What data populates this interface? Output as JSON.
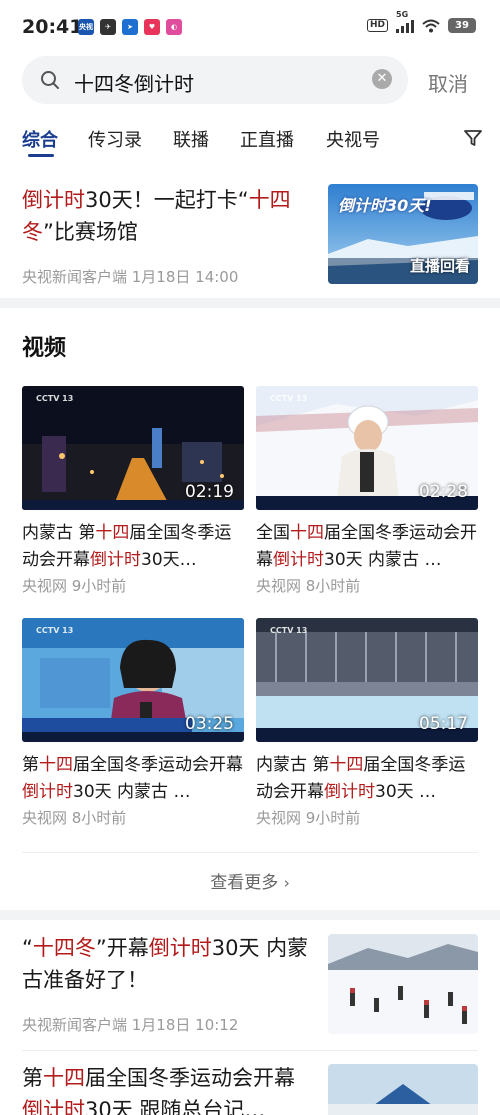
{
  "status_bar": {
    "time": "20:41",
    "hd_label": "HD",
    "network": "5G",
    "battery": "39",
    "apps": [
      {
        "label": "央视",
        "color": "#1a56b0"
      },
      {
        "label": "✈",
        "color": "#333333"
      },
      {
        "label": "➤",
        "color": "#1f6fd1"
      },
      {
        "label": "♥",
        "color": "#e8335a"
      },
      {
        "label": "◐",
        "color": "#e04d9c"
      }
    ]
  },
  "search": {
    "query": "十四冬倒计时",
    "cancel_label": "取消"
  },
  "tabs": [
    "综合",
    "传习录",
    "联播",
    "正直播",
    "央视号"
  ],
  "top_news": {
    "title_parts": [
      {
        "text": "倒计时",
        "hl": true
      },
      {
        "text": "30天！一起打卡“",
        "hl": false
      },
      {
        "text": "十四冬",
        "hl": true
      },
      {
        "text": "”比赛场馆",
        "hl": false
      }
    ],
    "meta": "央视新闻客户端  1月18日 14:00",
    "thumb_badge": "直播回看",
    "thumb_caption": "倒计时30天!"
  },
  "video_section": {
    "title": "视频",
    "more_label": "查看更多"
  },
  "videos": [
    {
      "duration": "02:19",
      "title_parts": [
        {
          "text": "内蒙古 第",
          "hl": false
        },
        {
          "text": "十四",
          "hl": true
        },
        {
          "text": "届全国冬季运动会开幕",
          "hl": false
        },
        {
          "text": "倒计时",
          "hl": true
        },
        {
          "text": "30天…",
          "hl": false
        }
      ],
      "meta": "央视网  9小时前"
    },
    {
      "duration": "02:28",
      "title_parts": [
        {
          "text": "全国",
          "hl": false
        },
        {
          "text": "十四",
          "hl": true
        },
        {
          "text": "届全国冬季运动会开幕",
          "hl": false
        },
        {
          "text": "倒计时",
          "hl": true
        },
        {
          "text": "30天 内蒙古 …",
          "hl": false
        }
      ],
      "meta": "央视网  8小时前"
    },
    {
      "duration": "03:25",
      "title_parts": [
        {
          "text": "第",
          "hl": false
        },
        {
          "text": "十四",
          "hl": true
        },
        {
          "text": "届全国冬季运动会开幕",
          "hl": false
        },
        {
          "text": "倒计时",
          "hl": true
        },
        {
          "text": "30天 内蒙古 …",
          "hl": false
        }
      ],
      "meta": "央视网  8小时前"
    },
    {
      "duration": "05:17",
      "title_parts": [
        {
          "text": "内蒙古 第",
          "hl": false
        },
        {
          "text": "十四",
          "hl": true
        },
        {
          "text": "届全国冬季运动会开幕",
          "hl": false
        },
        {
          "text": "倒计时",
          "hl": true
        },
        {
          "text": "30天 …",
          "hl": false
        }
      ],
      "meta": "央视网  9小时前"
    }
  ],
  "news_2": {
    "title_parts": [
      {
        "text": "“",
        "hl": false
      },
      {
        "text": "十四冬",
        "hl": true
      },
      {
        "text": "”开幕",
        "hl": false
      },
      {
        "text": "倒计时",
        "hl": true
      },
      {
        "text": "30天 内蒙古准备好了！",
        "hl": false
      }
    ],
    "meta": "央视新闻客户端  1月18日 10:12"
  },
  "news_3": {
    "title_parts": [
      {
        "text": "第",
        "hl": false
      },
      {
        "text": "十四",
        "hl": true
      },
      {
        "text": "届全国冬季运动会开幕",
        "hl": false
      },
      {
        "text": "倒计时",
        "hl": true
      },
      {
        "text": "30天 跟随总台记…",
        "hl": false
      }
    ]
  },
  "colors": {
    "accent": "#1a3d8f",
    "highlight": "#b31b1b",
    "meta": "#9a9a9a"
  }
}
